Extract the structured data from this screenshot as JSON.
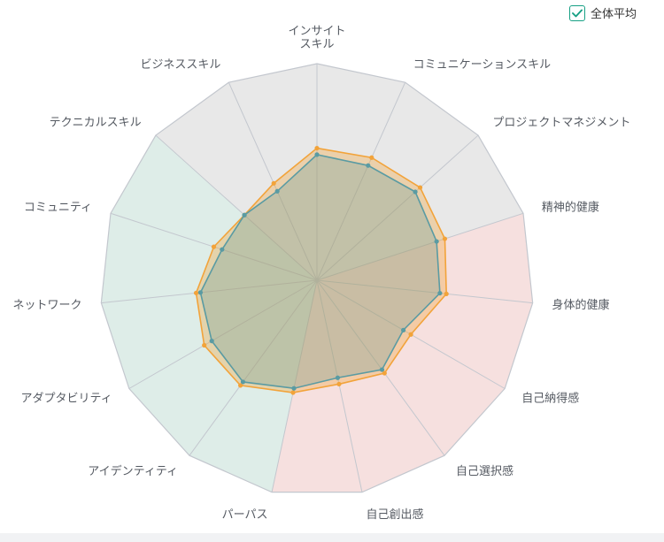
{
  "legend": {
    "label": "全体平均",
    "checked": true,
    "icon": "checkmark-icon",
    "check_color": "#17a084"
  },
  "colors": {
    "sector_gray": "#e8e8e8",
    "sector_pink": "#f6e0df",
    "sector_green": "#deede8",
    "grid_line": "#c3c7ce",
    "average_series": "#f2a33a",
    "user_series": "#5a9ba3"
  },
  "chart_data": {
    "type": "radar",
    "axes": [
      "インサイト\nスキル",
      "コミュニケーションスキル",
      "プロジェクトマネジメント",
      "精神的健康",
      "身体的健康",
      "自己納得感",
      "自己選択感",
      "自己創出感",
      "パーパス",
      "アイデンティティ",
      "アダプタビリティ",
      "ネットワーク",
      "コミュニティ",
      "テクニカルスキル",
      "ビジネススキル"
    ],
    "sector_groups": [
      {
        "color": "gray",
        "axes": [
          0,
          1,
          2,
          13,
          14
        ]
      },
      {
        "color": "pink",
        "axes": [
          3,
          4,
          5,
          6,
          7
        ]
      },
      {
        "color": "green",
        "axes": [
          8,
          9,
          10,
          11,
          12
        ]
      }
    ],
    "range": [
      0,
      100
    ],
    "series": [
      {
        "name": "全体平均",
        "values": [
          61,
          62,
          64,
          62,
          60,
          50,
          53,
          49,
          53,
          60,
          60,
          56,
          50,
          45,
          49
        ]
      },
      {
        "values": [
          58,
          58,
          61,
          58,
          57,
          46,
          51,
          46,
          51,
          58,
          56,
          54,
          46,
          45,
          45
        ]
      }
    ]
  }
}
